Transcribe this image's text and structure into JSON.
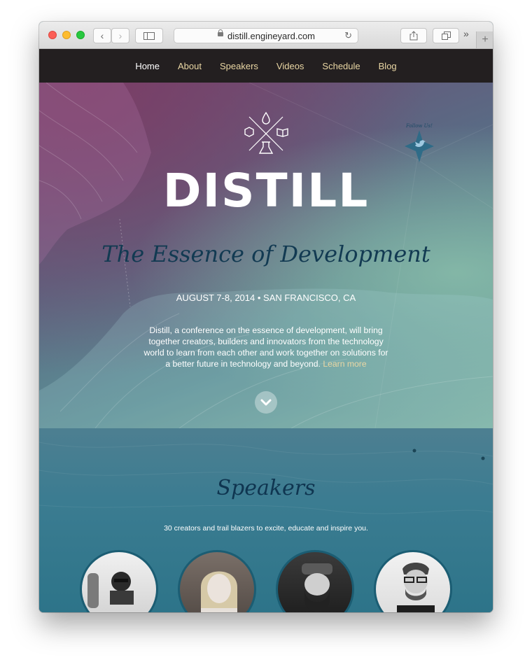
{
  "browser": {
    "url": "distill.engineyard.com"
  },
  "nav": {
    "items": [
      "Home",
      "About",
      "Speakers",
      "Videos",
      "Schedule",
      "Blog"
    ],
    "active": "Home"
  },
  "hero": {
    "logo": "DISTILL",
    "tagline": "The Essence of Development",
    "dates": "AUGUST 7-8, 2014 • SAN FRANCISCO, CA",
    "description": "Distill, a conference on the essence of development, will bring together creators, builders and innovators from the technology world to learn from each other and work together on solutions for a better future in technology and beyond.",
    "learn_more": "Learn more",
    "twitter_badge": "Follow Us!"
  },
  "speakers": {
    "title": "Speakers",
    "subtitle": "30 creators and trail blazers to excite, educate and inspire you."
  },
  "colors": {
    "nav_bg": "#231f20",
    "nav_link": "#ead7a4",
    "tagline": "#123a52",
    "section_bg": "#2d7489"
  }
}
